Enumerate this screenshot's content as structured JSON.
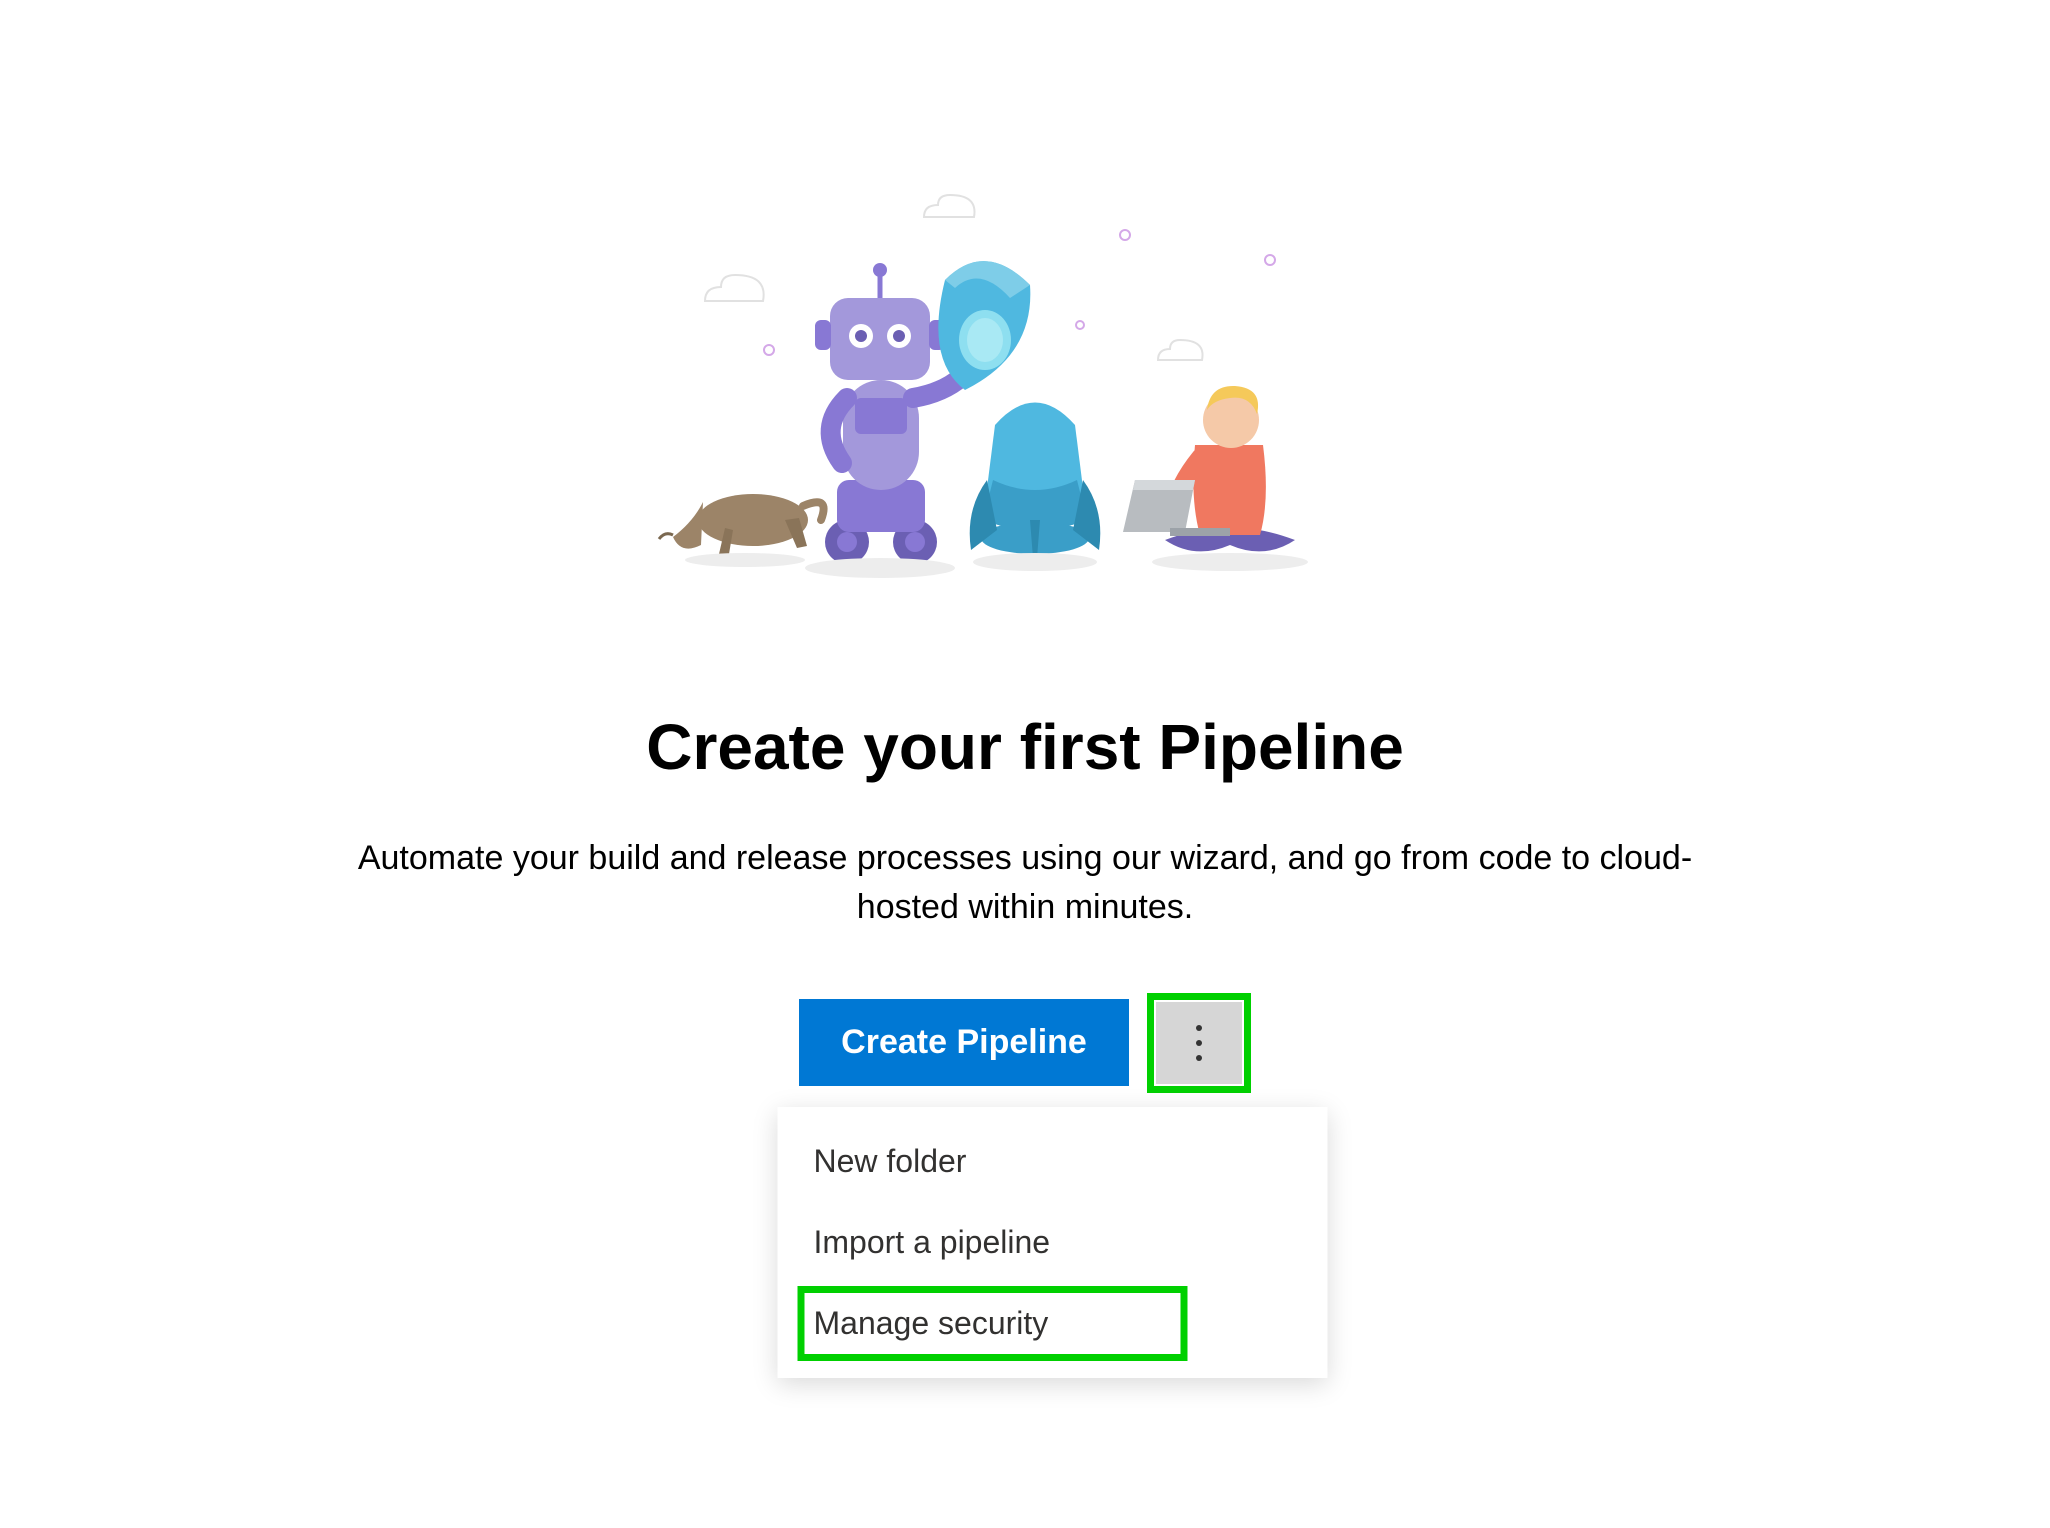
{
  "heading": "Create your first Pipeline",
  "description": "Automate your build and release processes using our wizard, and go from code to cloud-hosted within minutes.",
  "buttons": {
    "create_pipeline": "Create Pipeline"
  },
  "menu": {
    "items": [
      {
        "label": "New folder",
        "highlighted": false
      },
      {
        "label": "Import a pipeline",
        "highlighted": false
      },
      {
        "label": "Manage security",
        "highlighted": true
      }
    ]
  },
  "colors": {
    "primary": "#0078d4",
    "highlight": "#00d000"
  }
}
